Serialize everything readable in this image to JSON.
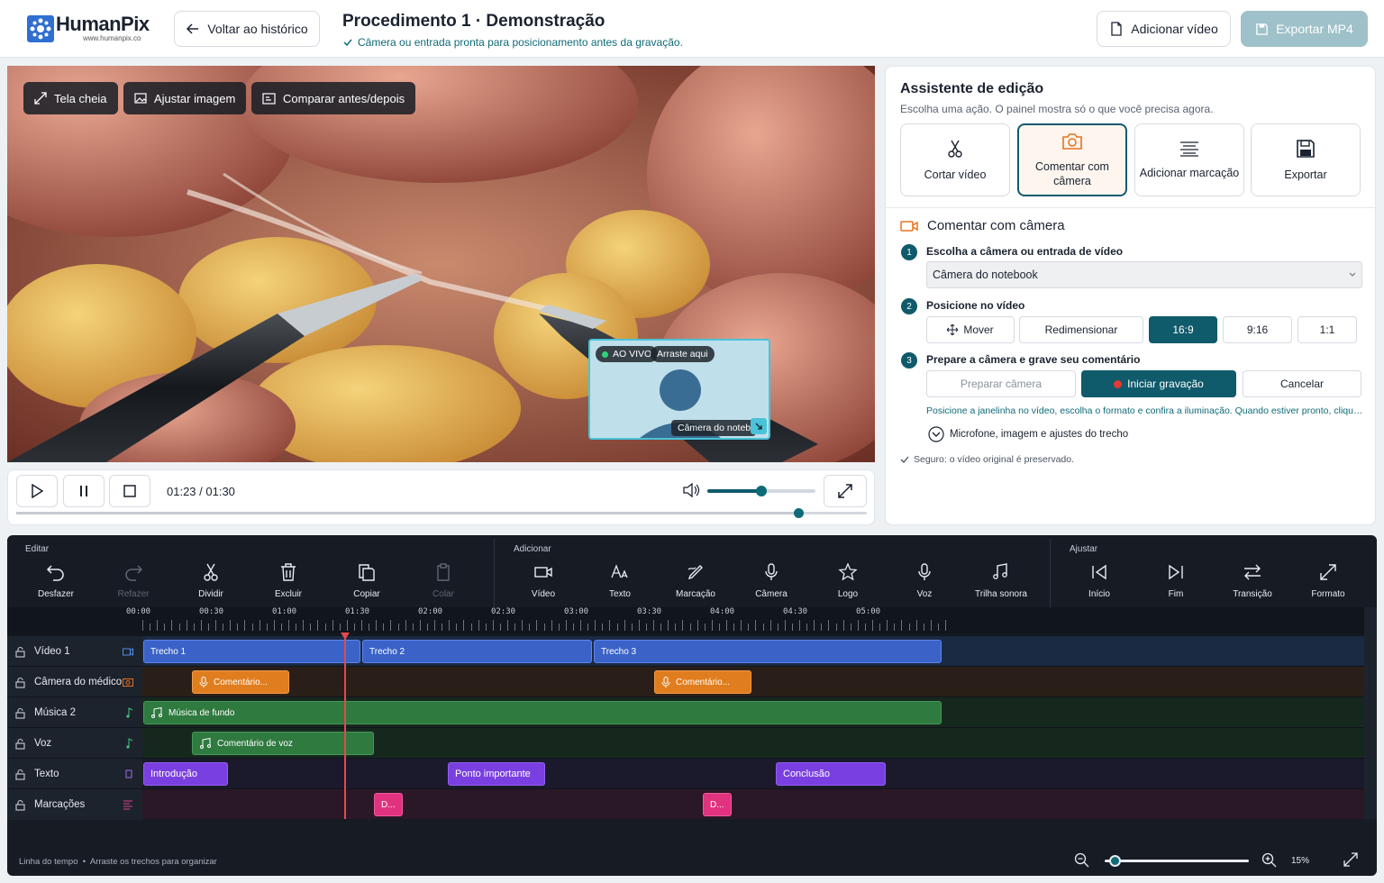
{
  "header": {
    "logo_name": "HumanPix",
    "logo_url": "www.humanpix.co",
    "back_label": "Voltar ao histórico",
    "title": "Procedimento 1 · Demonstração",
    "subtitle": "Câmera ou entrada pronta para posicionamento antes da gravação.",
    "add_video_label": "Adicionar vídeo",
    "export_label": "Exportar MP4"
  },
  "video": {
    "fullscreen_label": "Tela cheia",
    "adjust_label": "Ajustar imagem",
    "compare_label": "Comparar antes/depois",
    "pip": {
      "live_label": "AO VIVO",
      "drag_label": "Arraste aqui",
      "camera_label": "Câmera do notebook"
    }
  },
  "controls": {
    "time": "01:23 / 01:30",
    "volume_fraction": 0.5,
    "progress_fraction": 0.92
  },
  "panel": {
    "title": "Assistente de edição",
    "subtitle": "Escolha uma ação. O painel mostra só o que você precisa agora.",
    "cards": [
      "Cortar vídeo",
      "Comentar com câmera",
      "Adicionar marcação",
      "Exportar"
    ],
    "section_title": "Comentar com câmera",
    "step1": {
      "num": "1",
      "label": "Escolha a câmera ou entrada de vídeo",
      "select_value": "Câmera do notebook"
    },
    "step2": {
      "num": "2",
      "label": "Posicione no vídeo",
      "move": "Mover",
      "resize": "Redimensionar",
      "r169": "16:9",
      "r916": "9:16",
      "r11": "1:1"
    },
    "step3": {
      "num": "3",
      "label": "Prepare a câmera e grave seu comentário",
      "prepare": "Preparar câmera",
      "record": "Iniciar gravação",
      "cancel": "Cancelar"
    },
    "hint": "Posicione a janelinha no vídeo, escolha o formato e confira a iluminação. Quando estiver pronto, clique em Iniciar gravação.",
    "mic_settings": "Microfone, imagem e ajustes do trecho",
    "safe_note": "Seguro: o vídeo original é preservado."
  },
  "timeline": {
    "groups": {
      "edit": "Editar",
      "add": "Adicionar",
      "adjust": "Ajustar"
    },
    "tools": {
      "undo": "Desfazer",
      "redo": "Refazer",
      "split": "Dividir",
      "delete": "Excluir",
      "copy": "Copiar",
      "paste": "Colar",
      "video": "Vídeo",
      "text": "Texto",
      "markup": "Marcação",
      "camera": "Câmera",
      "logo": "Logo",
      "voice": "Voz",
      "soundtrack": "Trilha sonora",
      "start": "Início",
      "end": "Fim",
      "transition": "Transição",
      "format": "Formato"
    },
    "ticks": [
      "00:00",
      "00:30",
      "01:00",
      "01:30",
      "02:00",
      "02:30",
      "03:00",
      "03:30",
      "04:00",
      "04:30",
      "05:00"
    ],
    "tracks": {
      "video": "Vídeo 1",
      "camera": "Câmera do médico",
      "music": "Música 2",
      "voice": "Voz",
      "text": "Texto",
      "markers": "Marcações"
    },
    "clips": {
      "v1": "Trecho 1",
      "v2": "Trecho 2",
      "v3": "Trecho 3",
      "c1": "Comentário...",
      "c2": "Comentário...",
      "m1": "Música de fundo",
      "vo1": "Comentário de voz",
      "t1": "Introdução",
      "t2": "Ponto importante",
      "t3": "Conclusão",
      "mk1": "D...",
      "mk2": "D..."
    },
    "footer": "Linha do tempo  •  Arraste os trechos para organizar",
    "zoom": "15%",
    "zoom_fraction": 0.07
  }
}
